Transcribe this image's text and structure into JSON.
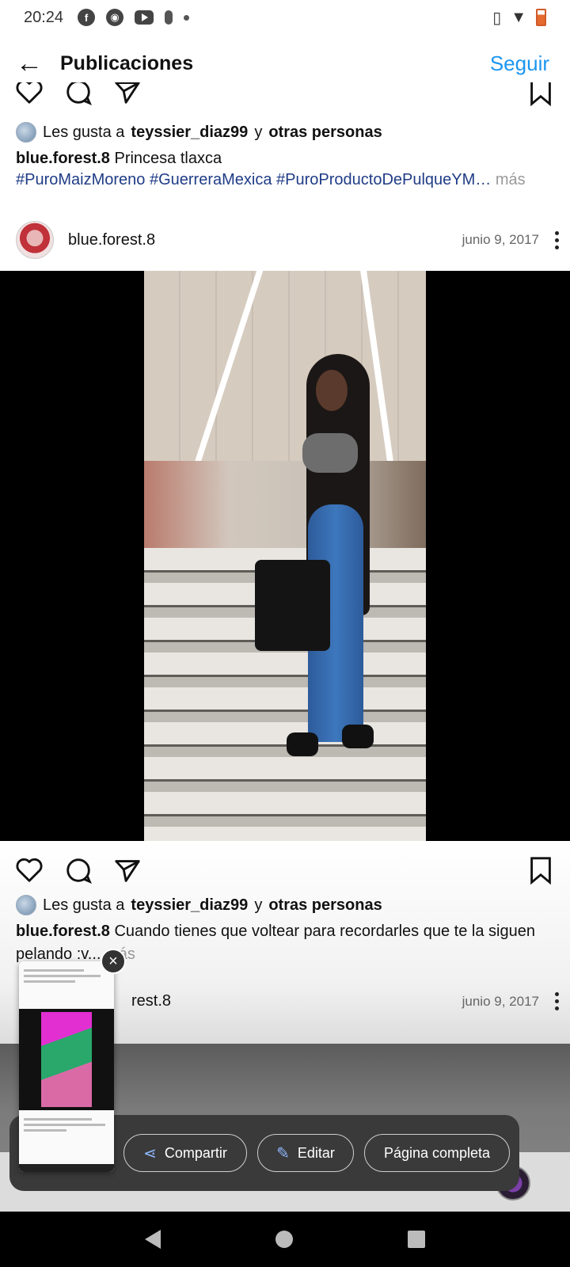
{
  "status_bar": {
    "time": "20:24"
  },
  "header": {
    "title": "Publicaciones",
    "follow_label": "Seguir"
  },
  "post1": {
    "likes_prefix": "Les gusta a",
    "likes_user": "teyssier_diaz99",
    "likes_joiner": "y",
    "likes_suffix": "otras personas",
    "caption_user": "blue.forest.8",
    "caption_text": "Princesa tlaxca",
    "hashtags": "#PuroMaizMoreno #GuerreraMexica #PuroProductoDePulqueYM…",
    "more_label": "más"
  },
  "post2": {
    "username": "blue.forest.8",
    "date": "junio 9, 2017",
    "likes_prefix": "Les gusta a",
    "likes_user": "teyssier_diaz99",
    "likes_joiner": "y",
    "likes_suffix": "otras personas",
    "caption_user": "blue.forest.8",
    "caption_text": "Cuando tienes que voltear para recordarles que te la siguen pelando :v...",
    "more_label": "más"
  },
  "post3": {
    "username_partial": "rest.8",
    "date": "junio 9, 2017"
  },
  "share_toolbar": {
    "share_label": "Compartir",
    "edit_label": "Editar",
    "fullpage_label": "Página completa"
  },
  "colors": {
    "accent": "#1c96f0",
    "hashtag": "#1f3c86"
  }
}
